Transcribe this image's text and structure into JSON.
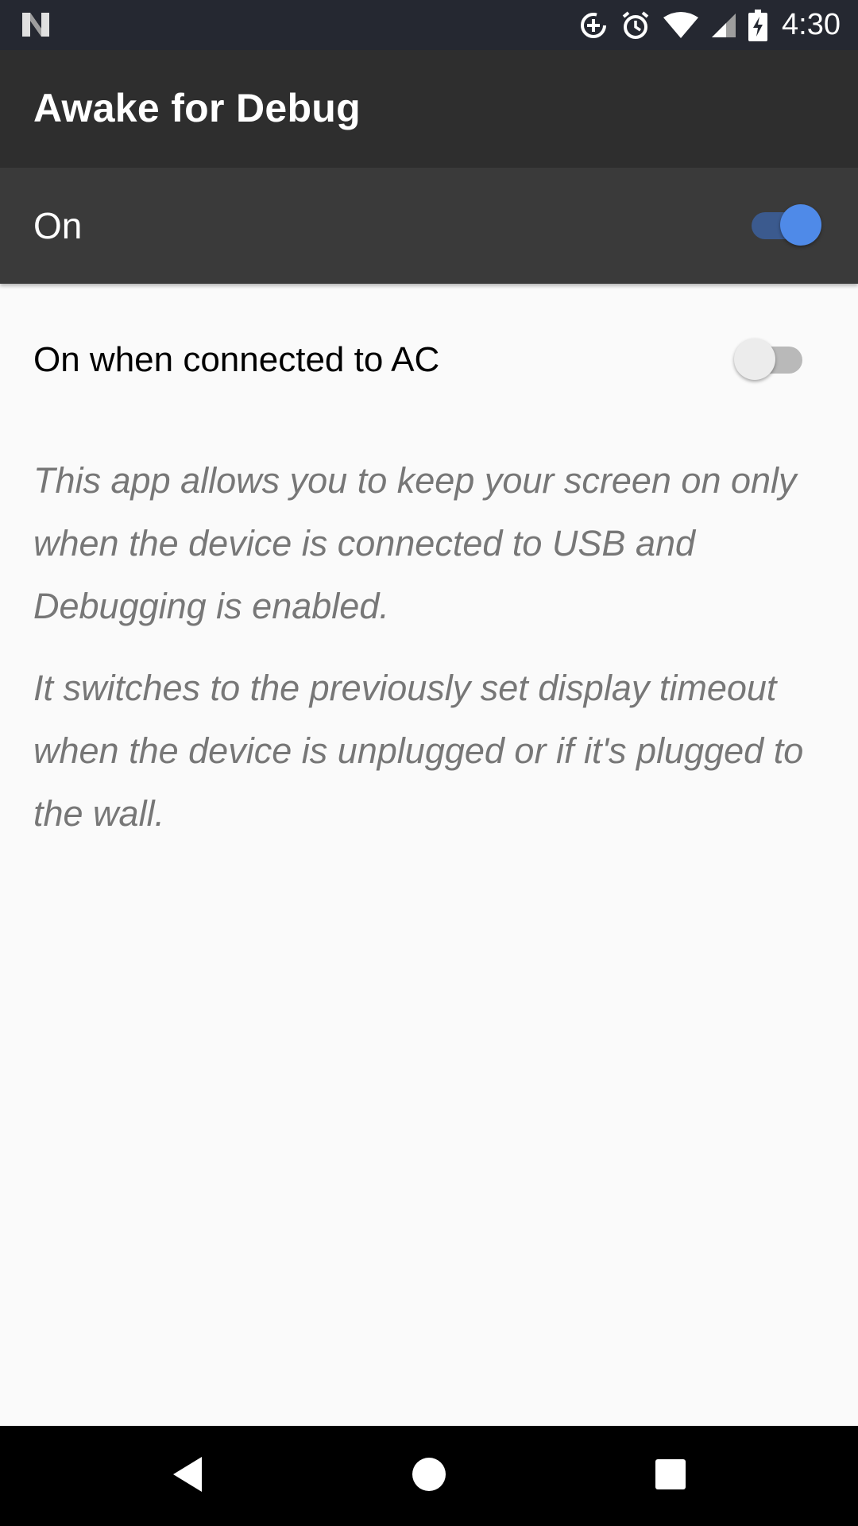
{
  "status_bar": {
    "time": "4:30",
    "icons": [
      "notification-n-icon",
      "data-saver-icon",
      "alarm-icon",
      "wifi-icon",
      "cell-signal-icon",
      "battery-charging-icon"
    ]
  },
  "app_bar": {
    "title": "Awake for Debug"
  },
  "master_switch": {
    "label": "On",
    "checked": true,
    "accent_color": "#4f8ae8"
  },
  "settings": {
    "ac_label": "On when connected to AC",
    "ac_checked": false
  },
  "description": {
    "paragraph_1": "This app allows you to keep your screen on only when the device is connected to USB and Debugging is enabled.",
    "paragraph_2": "It switches to the previously set display timeout when the device is unplugged or if it's plugged to the wall."
  },
  "nav_bar": {
    "icons": [
      "back-icon",
      "home-icon",
      "recents-icon"
    ]
  }
}
